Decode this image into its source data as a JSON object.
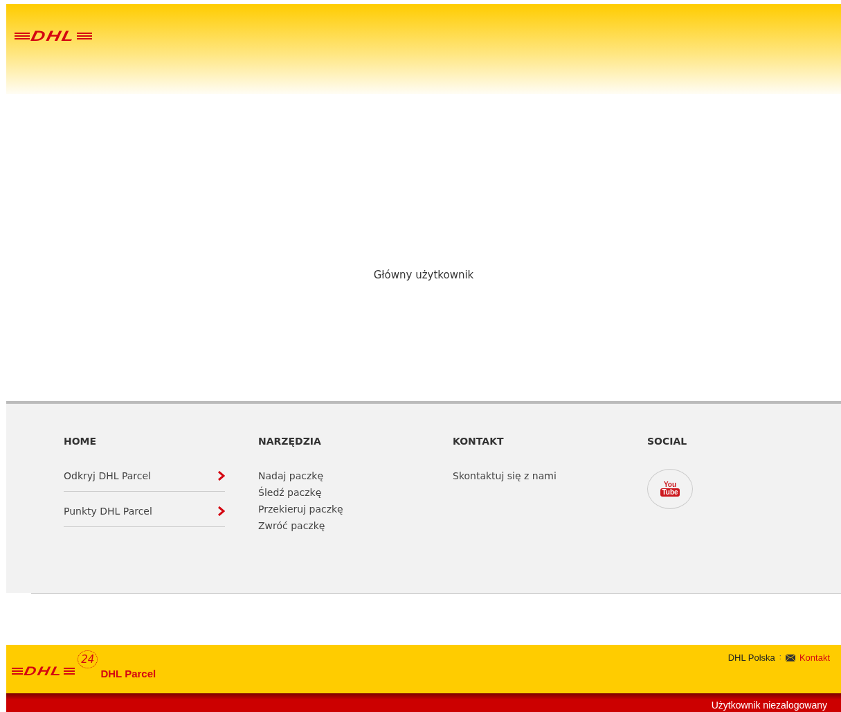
{
  "header": {
    "logo": "DHL"
  },
  "main": {
    "text": "Główny użytkownik"
  },
  "footer": {
    "columns": [
      {
        "heading": "HOME",
        "kind": "arrow-list",
        "items": [
          "Odkryj DHL Parcel",
          "Punkty DHL Parcel"
        ]
      },
      {
        "heading": "NARZĘDZIA",
        "kind": "links",
        "items": [
          "Nadaj paczkę",
          "Śledź paczkę",
          "Przekieruj paczkę",
          "Zwróć paczkę"
        ]
      },
      {
        "heading": "KONTAKT",
        "kind": "links",
        "items": [
          "Skontaktuj się z nami"
        ]
      },
      {
        "heading": "SOCIAL",
        "kind": "social",
        "items": [
          "You",
          "Tube"
        ]
      }
    ]
  },
  "bottom_bar": {
    "logo": "DHL",
    "badge": "24",
    "brand": "DHL Parcel",
    "links": [
      "DHL Polska",
      "Kontakt"
    ],
    "separator": ":",
    "user_status": "Użytkownik niezalogowany"
  }
}
